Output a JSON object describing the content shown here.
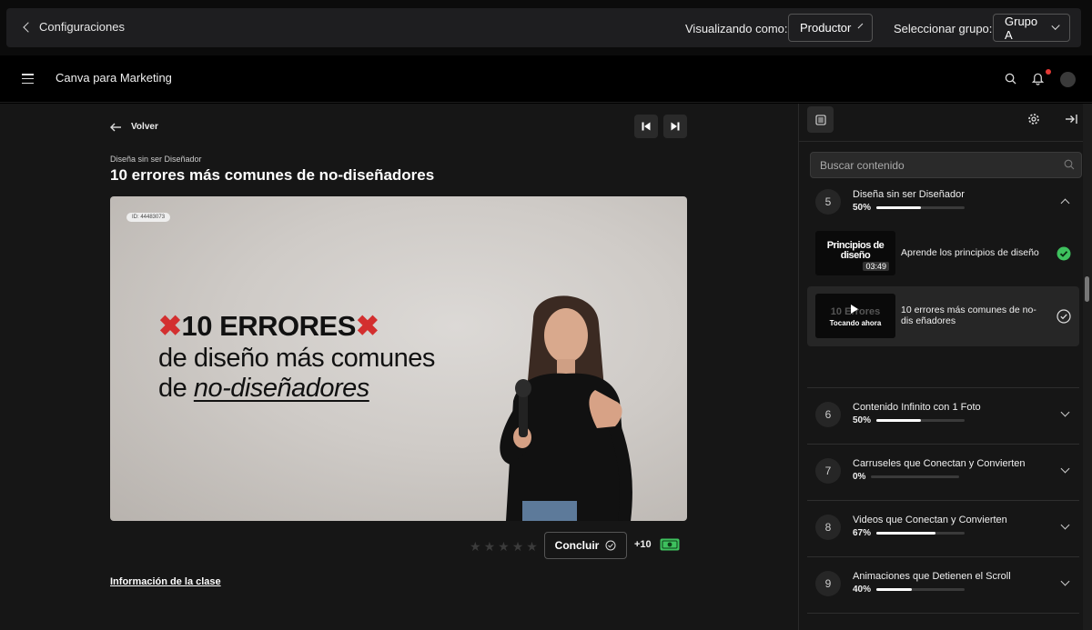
{
  "config_bar": {
    "back_label": "Configuraciones",
    "viewing_as_label": "Visualizando como:",
    "viewing_as_value": "Productor",
    "group_label": "Seleccionar grupo:",
    "group_value": "Grupo A"
  },
  "app_header": {
    "title": "Canva para Marketing"
  },
  "lesson": {
    "back_label": "Volver",
    "module_name": "Diseña sin ser Diseñador",
    "title": "10 errores más comunes de no-diseñadores",
    "video": {
      "id_badge": "ID: 44483073",
      "line1": "10 ERRORES",
      "line2": "de diseño más comunes",
      "line3_prefix": "de ",
      "line3_em": "no-diseñadores"
    },
    "conclude_label": "Concluir",
    "points": "+10",
    "info_link": "Información de la clase",
    "rating_max": 5,
    "rating_value": 0
  },
  "sidebar": {
    "search_placeholder": "Buscar contenido",
    "modules": [
      {
        "number": "5",
        "title": "Diseña sin ser Diseñador",
        "percent_label": "50%",
        "progress": 0.5,
        "expanded": true,
        "lessons": [
          {
            "thumb_title": "Principios de diseño",
            "duration": "03:49",
            "name": "Aprende los principios de diseño",
            "completed": true,
            "active": false
          },
          {
            "thumb_title": "10 Errores",
            "playing_label": "Tocando ahora",
            "name": "10 errores más comunes de no-dis eñadores",
            "completed": false,
            "active": true
          }
        ]
      },
      {
        "number": "6",
        "title": "Contenido Infinito con 1 Foto",
        "percent_label": "50%",
        "progress": 0.5
      },
      {
        "number": "7",
        "title": "Carruseles que Conectan y Convierten",
        "percent_label": "0%",
        "progress": 0
      },
      {
        "number": "8",
        "title": "Videos que Conectan y Convierten",
        "percent_label": "67%",
        "progress": 0.67
      },
      {
        "number": "9",
        "title": "Animaciones que Detienen el Scroll",
        "percent_label": "40%",
        "progress": 0.4
      }
    ]
  },
  "colors": {
    "accent_green": "#3ec15e",
    "notification": "#e53935",
    "mark_red": "#d32f2f"
  }
}
